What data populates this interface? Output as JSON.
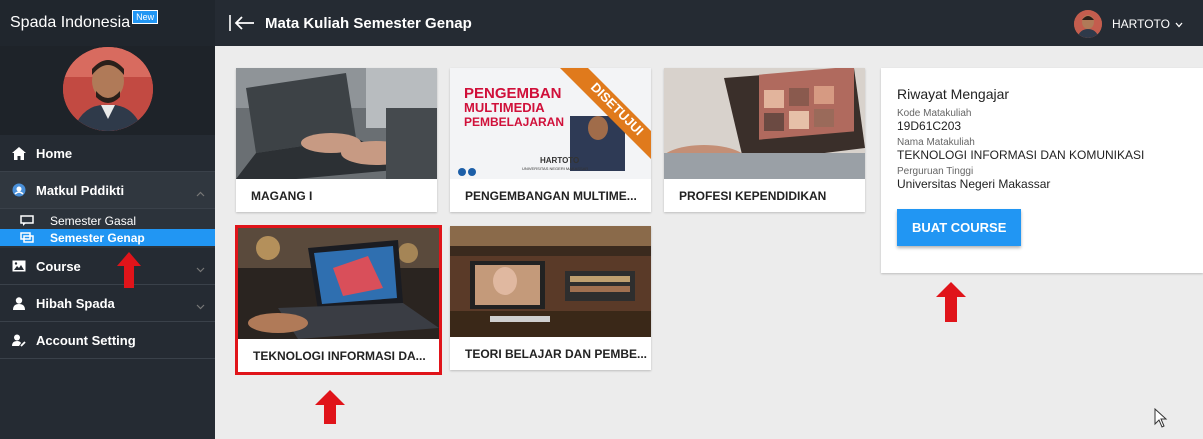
{
  "sidebar": {
    "brand": "Spada Indonesia",
    "brand_badge": "New",
    "menu": {
      "home": "Home",
      "matkul": "Matkul Pddikti",
      "semester_gasal": "Semester Gasal",
      "semester_genap": "Semester Genap",
      "course": "Course",
      "hibah": "Hibah Spada",
      "account": "Account Setting"
    }
  },
  "header": {
    "title": "Mata Kuliah Semester Genap",
    "user": "HARTOTO"
  },
  "courses": [
    {
      "label": "MAGANG I"
    },
    {
      "label": "PENGEMBANGAN MULTIME..."
    },
    {
      "label": "PROFESI KEPENDIDIKAN"
    },
    {
      "label": "TEKNOLOGI INFORMASI DA..."
    },
    {
      "label": "TEORI BELAJAR DAN PEMBE..."
    }
  ],
  "course2_cover": {
    "line1": "PENGEMBAN",
    "line2": "MULTIMEDIA",
    "line3": "PEMBELAJARAN",
    "ribbon": "DISETUJUI",
    "author": "HARTOTO",
    "author_sub": "UNIVERSITAS NEGERI MAKASSAR"
  },
  "panel": {
    "title": "Riwayat Mengajar",
    "kode_label": "Kode Matakuliah",
    "kode_value": "19D61C203",
    "nama_label": "Nama Matakuliah",
    "nama_value": "TEKNOLOGI INFORMASI DAN KOMUNIKASI",
    "pt_label": "Perguruan Tinggi",
    "pt_value": "Universitas Negeri Makassar",
    "button": "BUAT COURSE"
  },
  "colors": {
    "accent": "#2196f3",
    "sidebar_bg": "#252b33",
    "highlight_red": "#e0141a"
  }
}
